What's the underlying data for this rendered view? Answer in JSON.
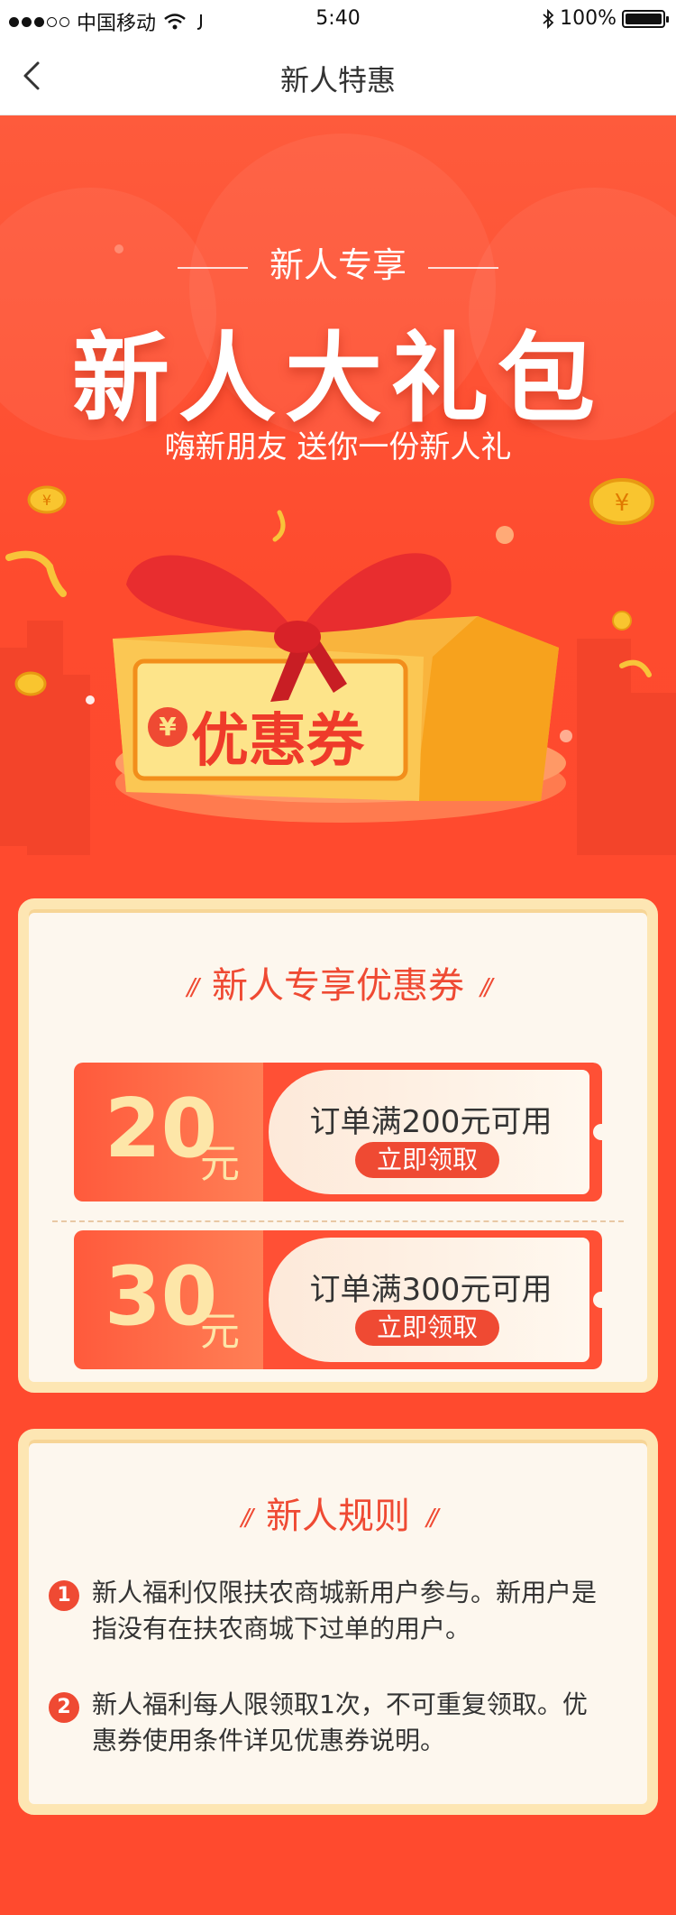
{
  "status_bar": {
    "carrier": "中国移动",
    "time": "5:40",
    "battery": "100%"
  },
  "nav": {
    "title": "新人特惠"
  },
  "hero": {
    "subtitle": "新人专享",
    "title": "新人大礼包",
    "tagline": "嗨新朋友 送你一份新人礼",
    "gift_label": "优惠券",
    "currency_symbol": "¥"
  },
  "coupons_section": {
    "title": "新人专享优惠券",
    "coupons": [
      {
        "amount": "20",
        "unit": "元",
        "condition": "订单满200元可用",
        "button": "立即领取"
      },
      {
        "amount": "30",
        "unit": "元",
        "condition": "订单满300元可用",
        "button": "立即领取"
      }
    ]
  },
  "rules_section": {
    "title": "新人规则",
    "rules": [
      {
        "num": "1",
        "text": "新人福利仅限扶农商城新用户参与。新用户是指没有在扶农商城下过单的用户。"
      },
      {
        "num": "2",
        "text": "新人福利每人限领取1次，不可重复领取。优惠券使用条件详见优惠券说明。"
      }
    ]
  },
  "colors": {
    "primary": "#ef4a33",
    "gold": "#fde6a8",
    "card_border": "#fde6b3",
    "background": "#ff4a2e"
  }
}
